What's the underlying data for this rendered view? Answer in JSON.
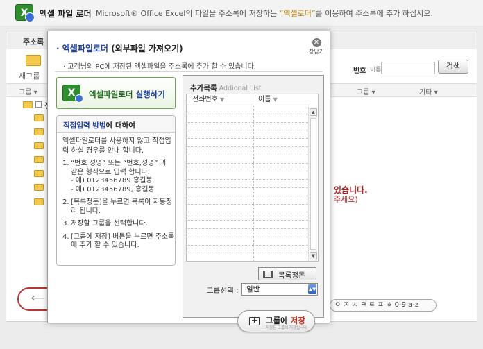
{
  "header": {
    "logo_glyph": "X",
    "title": "엑셀 파일 로더",
    "desc_pre": "Microsoft® Office Excel의 파일을 주소록에 저장하는 ",
    "desc_highlight": "“엑셀로더”",
    "desc_post": "를 이용하여 주소록에 추가 하십시오."
  },
  "background": {
    "tab_label": "주소록",
    "new_group": "새그룹",
    "col_group": "그룹 ▾",
    "col_group2": "그룹 ▾",
    "col_etc": "기타 ▾",
    "search_num_label": "번호",
    "search_name_label": "이름",
    "search_button": "검색",
    "root_label": "전",
    "msg_bold": "있습니다.",
    "msg_sub": "주세요)",
    "index_text": "ㅇ ㅈ ㅊ ㅋ ㅌ ㅍ ㅎ 0-9 a-z"
  },
  "modal": {
    "title_blue": "· 엑셀파일로더",
    "title_rest": " (외부파일 가져오기)",
    "close_glyph": "✕",
    "close_label": "창닫기",
    "description": "· 고객님의 PC에 저장된 엑셀파일을 주소록에 추가 할 수 있습니다.",
    "run_button": {
      "label": "엑셀파일로더 ",
      "accent": "실행하기"
    },
    "direct_input": {
      "title_blue": "직접입력 방법",
      "title_rest": "에 대하여",
      "intro": "엑셀파일로더를 사용하지 않고 직접입력 하실 경우를 안내 합니다.",
      "steps": [
        {
          "num": "1.",
          "text": "“번호 성명” 또는 “번호,성명” 과 같은 형식으로 입력 합니다.\n - 예) 0123456789 홍길동\n - 예) 0123456789, 홍길동"
        },
        {
          "num": "2.",
          "text": "[목록정돈]을 누르면 목록이 자동정리 됩니다."
        },
        {
          "num": "3.",
          "text": "저장할 그룹을 선택합니다."
        },
        {
          "num": "4.",
          "text": "[그룹에 저장] 버튼을 누르면 주소록에 추가 할 수 있습니다."
        }
      ]
    },
    "add_list": {
      "title": "추가목록",
      "title_en": " Addional List",
      "col_phone": "전화번호",
      "col_name": "이름",
      "col_arrow": "▼",
      "sort_button": "목록정돈",
      "group_select_label": "그룹선택 :",
      "group_select_value": "일반",
      "save_label": "그룹에 ",
      "save_label_red": "저장",
      "save_sub": "지정된 그룹에 저장됩니다."
    }
  }
}
